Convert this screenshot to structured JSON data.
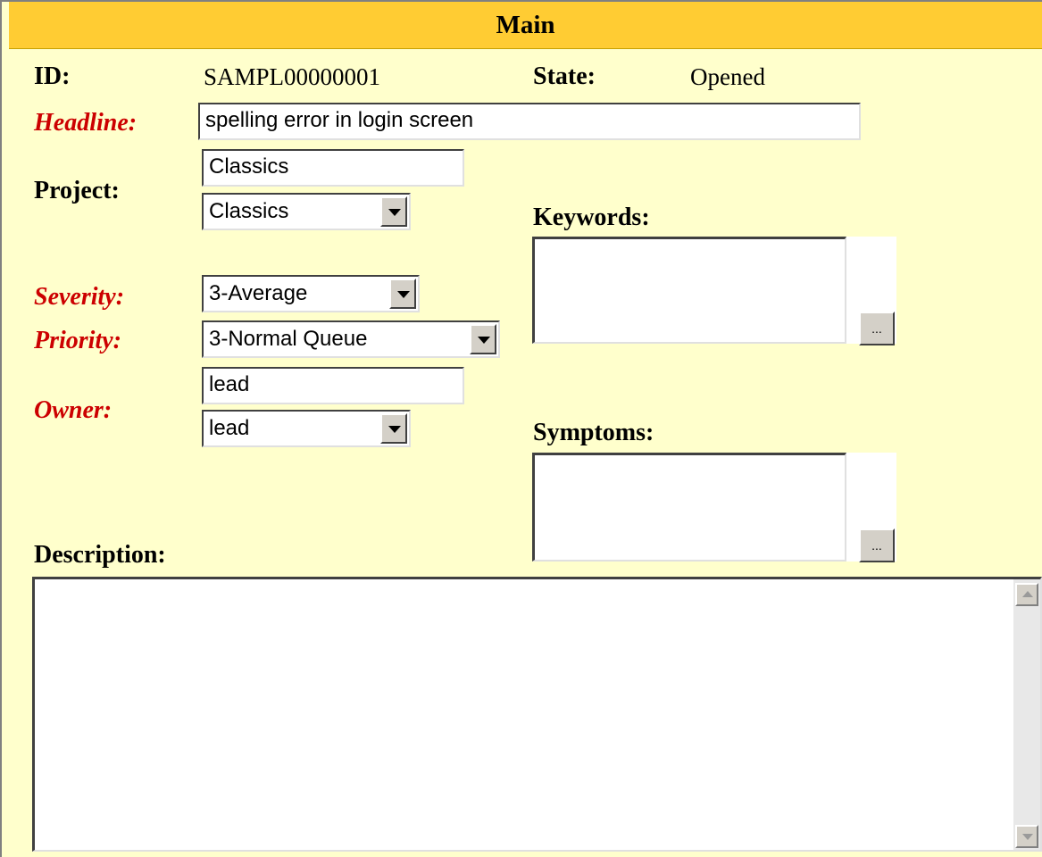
{
  "header": {
    "title": "Main"
  },
  "fields": {
    "id": {
      "label": "ID:",
      "value": "SAMPL00000001"
    },
    "state": {
      "label": "State:",
      "value": "Opened"
    },
    "headline": {
      "label": "Headline:",
      "value": "spelling error in login screen"
    },
    "project": {
      "label": "Project:",
      "text_value": "Classics",
      "selected": "Classics"
    },
    "keywords": {
      "label": "Keywords:",
      "button_label": "..."
    },
    "severity": {
      "label": "Severity:",
      "selected": "3-Average"
    },
    "priority": {
      "label": "Priority:",
      "selected": "3-Normal Queue"
    },
    "owner": {
      "label": "Owner:",
      "text_value": "lead",
      "selected": "lead"
    },
    "symptoms": {
      "label": "Symptoms:",
      "button_label": "..."
    },
    "description": {
      "label": "Description:",
      "value": ""
    }
  },
  "colors": {
    "background": "#ffffcc",
    "header": "#ffcc33",
    "required_label": "#cc0000"
  }
}
